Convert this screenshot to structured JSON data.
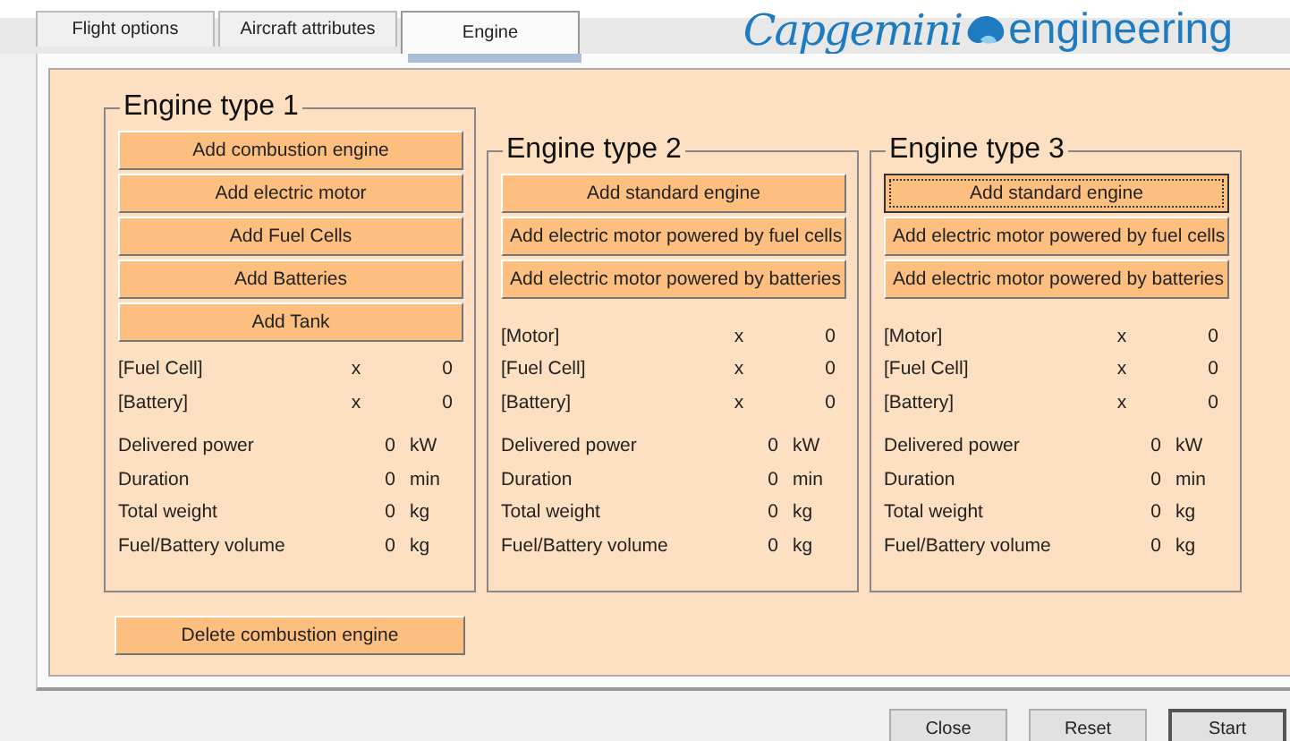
{
  "tabs": [
    {
      "label": "Flight options",
      "selected": false
    },
    {
      "label": "Aircraft attributes",
      "selected": false
    },
    {
      "label": "Engine",
      "selected": true
    }
  ],
  "logo": {
    "brand": "Capgemini",
    "suffix": "engineering"
  },
  "engine_groups": [
    {
      "title": "Engine type 1",
      "buttons": [
        {
          "label": "Add combustion engine",
          "focused": false
        },
        {
          "label": "Add electric motor",
          "focused": false
        },
        {
          "label": "Add Fuel Cells",
          "focused": false
        },
        {
          "label": "Add Batteries",
          "focused": false
        },
        {
          "label": "Add Tank",
          "focused": false
        }
      ],
      "rows": [
        {
          "kind": "count",
          "label": "[Fuel Cell]",
          "x": "x",
          "value": "0"
        },
        {
          "kind": "count",
          "label": "[Battery]",
          "x": "x",
          "value": "0"
        },
        {
          "kind": "metric",
          "label": "Delivered power",
          "value": "0",
          "unit": "kW"
        },
        {
          "kind": "metric",
          "label": "Duration",
          "value": "0",
          "unit": "min"
        },
        {
          "kind": "metric",
          "label": "Total weight",
          "value": "0",
          "unit": "kg"
        },
        {
          "kind": "metric",
          "label": "Fuel/Battery volume",
          "value": "0",
          "unit": "kg"
        }
      ]
    },
    {
      "title": "Engine type 2",
      "buttons": [
        {
          "label": "Add standard engine",
          "focused": false
        },
        {
          "label": "Add electric motor powered by fuel cells",
          "focused": false
        },
        {
          "label": "Add electric motor powered by batteries",
          "focused": false
        }
      ],
      "rows": [
        {
          "kind": "count",
          "label": "[Motor]",
          "x": "x",
          "value": "0"
        },
        {
          "kind": "count",
          "label": "[Fuel Cell]",
          "x": "x",
          "value": "0"
        },
        {
          "kind": "count",
          "label": "[Battery]",
          "x": "x",
          "value": "0"
        },
        {
          "kind": "metric",
          "label": "Delivered power",
          "value": "0",
          "unit": "kW"
        },
        {
          "kind": "metric",
          "label": "Duration",
          "value": "0",
          "unit": "min"
        },
        {
          "kind": "metric",
          "label": "Total weight",
          "value": "0",
          "unit": "kg"
        },
        {
          "kind": "metric",
          "label": "Fuel/Battery volume",
          "value": "0",
          "unit": "kg"
        }
      ]
    },
    {
      "title": "Engine type 3",
      "buttons": [
        {
          "label": "Add standard engine",
          "focused": true
        },
        {
          "label": "Add electric motor powered by fuel cells",
          "focused": false
        },
        {
          "label": "Add electric motor powered by batteries",
          "focused": false
        }
      ],
      "rows": [
        {
          "kind": "count",
          "label": "[Motor]",
          "x": "x",
          "value": "0"
        },
        {
          "kind": "count",
          "label": "[Fuel Cell]",
          "x": "x",
          "value": "0"
        },
        {
          "kind": "count",
          "label": "[Battery]",
          "x": "x",
          "value": "0"
        },
        {
          "kind": "metric",
          "label": "Delivered power",
          "value": "0",
          "unit": "kW"
        },
        {
          "kind": "metric",
          "label": "Duration",
          "value": "0",
          "unit": "min"
        },
        {
          "kind": "metric",
          "label": "Total weight",
          "value": "0",
          "unit": "kg"
        },
        {
          "kind": "metric",
          "label": "Fuel/Battery volume",
          "value": "0",
          "unit": "kg"
        }
      ]
    }
  ],
  "delete_button": "Delete combustion engine",
  "footer_buttons": [
    {
      "label": "Close",
      "default": false
    },
    {
      "label": "Reset",
      "default": false
    },
    {
      "label": "Start",
      "default": true
    }
  ]
}
